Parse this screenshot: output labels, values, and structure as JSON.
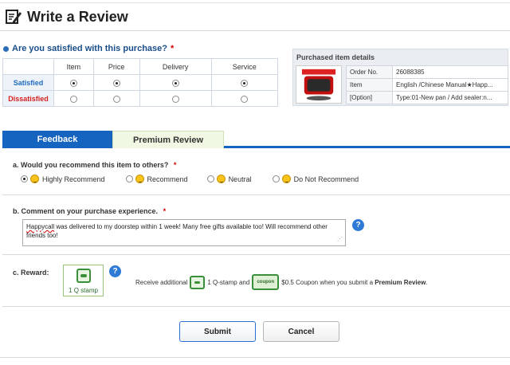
{
  "header": {
    "title": "Write a Review",
    "icon": "edit-icon"
  },
  "satisfaction": {
    "question": "Are you satisfied with this purchase?",
    "required_mark": "*",
    "columns": [
      "Item",
      "Price",
      "Delivery",
      "Service"
    ],
    "rows": [
      {
        "label": "Satisfied",
        "selected": [
          true,
          true,
          true,
          true
        ]
      },
      {
        "label": "Dissatisfied",
        "selected": [
          false,
          false,
          false,
          false
        ]
      }
    ]
  },
  "purchase_details": {
    "title": "Purchased item details",
    "rows": [
      {
        "key": "Order No.",
        "value": "26088385"
      },
      {
        "key": "Item",
        "value": "English /Chinese Manual★Happ..."
      },
      {
        "key": "[Option]",
        "value": "Type:01-New pan / Add sealer:n..."
      }
    ]
  },
  "tabs": {
    "active": "Feedback",
    "inactive": "Premium Review"
  },
  "recommend": {
    "label": "a. Would you recommend this item to others?",
    "required_mark": "*",
    "options": [
      "Highly Recommend",
      "Recommend",
      "Neutral",
      "Do Not Recommend"
    ],
    "selected_index": 0
  },
  "comment": {
    "label": "b. Comment on your purchase experience.",
    "required_mark": "*",
    "value_first_word": "Happycall",
    "value_rest": " was delivered to my doorstep within 1 week! Many free gifts available too! Will recommend other friends too!"
  },
  "reward": {
    "label": "c. Reward:",
    "stamp_label": "1 Q stamp",
    "text_prefix": "Receive additional",
    "text_stamp": "1 Q-stamp and",
    "coupon_icon_text": "coupon",
    "text_coupon": "$0.5 Coupon when you submit a",
    "text_premium": "Premium Review",
    "text_end": "."
  },
  "help_label": "?",
  "buttons": {
    "submit": "Submit",
    "cancel": "Cancel"
  },
  "colors": {
    "accent": "#1565c0",
    "satisfied": "#1f6cc1",
    "dissatisfied": "#d42020",
    "required": "#d40000"
  }
}
